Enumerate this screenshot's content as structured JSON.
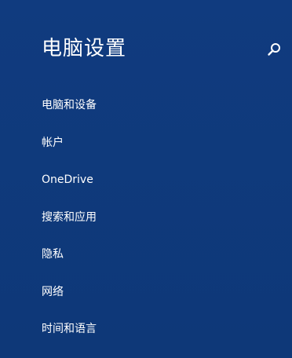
{
  "header": {
    "title": "电脑设置",
    "search_icon": "search-icon"
  },
  "nav": {
    "items": [
      {
        "label": "电脑和设备"
      },
      {
        "label": "帐户"
      },
      {
        "label": "OneDrive"
      },
      {
        "label": "搜索和应用"
      },
      {
        "label": "隐私"
      },
      {
        "label": "网络"
      },
      {
        "label": "时间和语言"
      }
    ]
  },
  "colors": {
    "background": "#0f3a7d",
    "text": "#ffffff"
  }
}
